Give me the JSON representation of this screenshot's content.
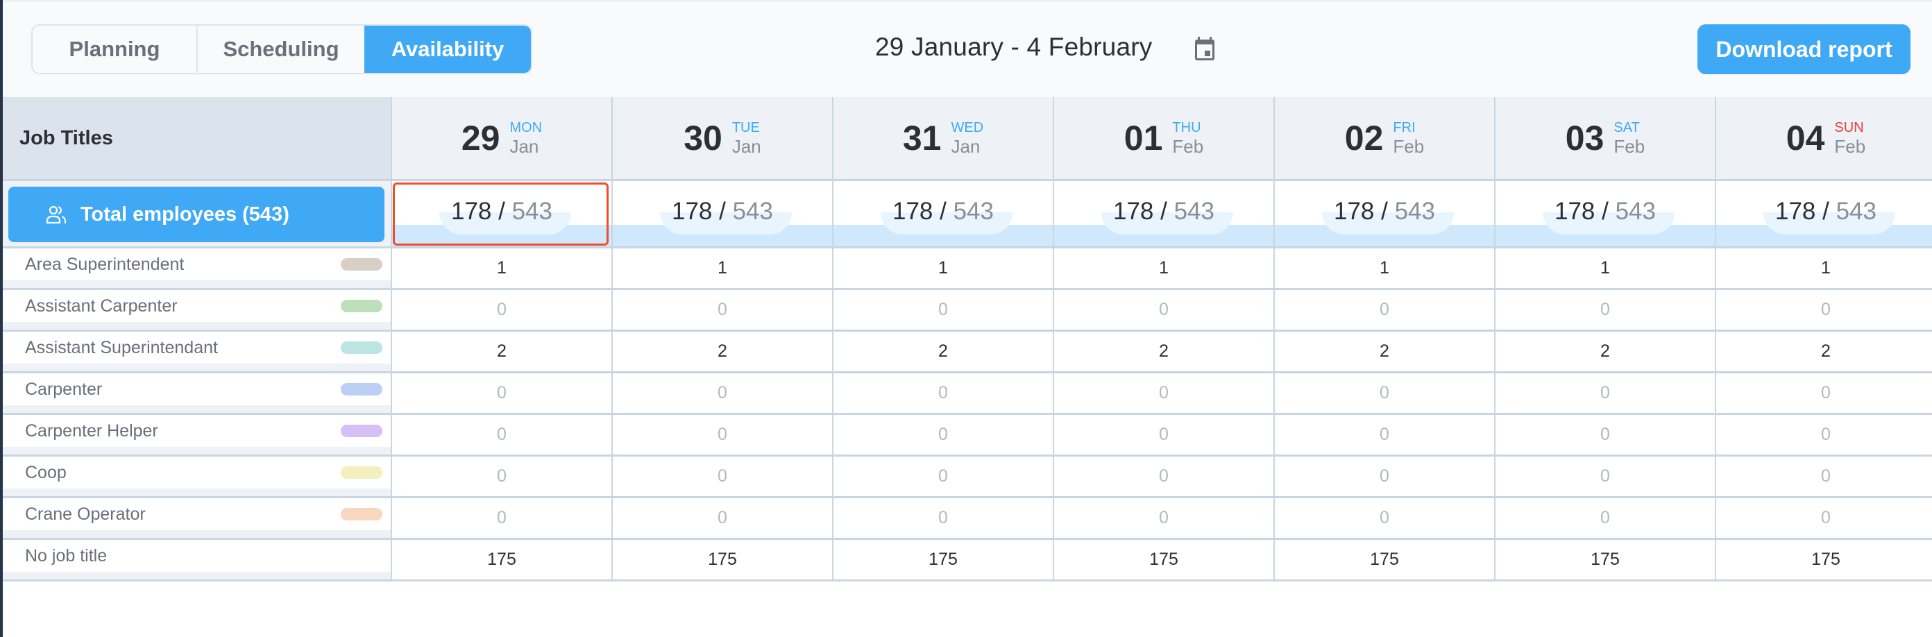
{
  "tabs": [
    {
      "label": "Planning",
      "active": false
    },
    {
      "label": "Scheduling",
      "active": false
    },
    {
      "label": "Availability",
      "active": true
    }
  ],
  "date_range": "29 January - 4 February",
  "calendar_icon": "calendar-icon",
  "download_label": "Download report",
  "colors": {
    "accent": "#3fa9f5",
    "weekday": "#3fa9f5",
    "sunday": "#f03a3a",
    "selection": "#f04e2a"
  },
  "grid": {
    "header_label": "Job Titles",
    "days": [
      {
        "num": "29",
        "dow": "MON",
        "month": "Jan"
      },
      {
        "num": "30",
        "dow": "TUE",
        "month": "Jan"
      },
      {
        "num": "31",
        "dow": "WED",
        "month": "Jan"
      },
      {
        "num": "01",
        "dow": "THU",
        "month": "Feb"
      },
      {
        "num": "02",
        "dow": "FRI",
        "month": "Feb"
      },
      {
        "num": "03",
        "dow": "SAT",
        "month": "Feb"
      },
      {
        "num": "04",
        "dow": "SUN",
        "month": "Feb"
      }
    ],
    "total": {
      "label": "Total employees (543)",
      "icon": "users-icon",
      "values": [
        {
          "available": "178",
          "total": "543",
          "selected": true
        },
        {
          "available": "178",
          "total": "543",
          "selected": false
        },
        {
          "available": "178",
          "total": "543",
          "selected": false
        },
        {
          "available": "178",
          "total": "543",
          "selected": false
        },
        {
          "available": "178",
          "total": "543",
          "selected": false
        },
        {
          "available": "178",
          "total": "543",
          "selected": false
        },
        {
          "available": "178",
          "total": "543",
          "selected": false
        }
      ]
    },
    "rows": [
      {
        "title": "Area Superintendent",
        "color": "#d9d0c5",
        "values": [
          "1",
          "1",
          "1",
          "1",
          "1",
          "1",
          "1"
        ]
      },
      {
        "title": "Assistant Carpenter",
        "color": "#bde0bb",
        "values": [
          "0",
          "0",
          "0",
          "0",
          "0",
          "0",
          "0"
        ]
      },
      {
        "title": "Assistant Superintendant",
        "color": "#bde5e4",
        "values": [
          "2",
          "2",
          "2",
          "2",
          "2",
          "2",
          "2"
        ]
      },
      {
        "title": "Carpenter",
        "color": "#bcd0f6",
        "values": [
          "0",
          "0",
          "0",
          "0",
          "0",
          "0",
          "0"
        ]
      },
      {
        "title": "Carpenter Helper",
        "color": "#d6bff6",
        "values": [
          "0",
          "0",
          "0",
          "0",
          "0",
          "0",
          "0"
        ]
      },
      {
        "title": "Coop",
        "color": "#f4efbe",
        "values": [
          "0",
          "0",
          "0",
          "0",
          "0",
          "0",
          "0"
        ]
      },
      {
        "title": "Crane Operator",
        "color": "#f8d7c0",
        "values": [
          "0",
          "0",
          "0",
          "0",
          "0",
          "0",
          "0"
        ]
      },
      {
        "title": "No job title",
        "color": null,
        "values": [
          "175",
          "175",
          "175",
          "175",
          "175",
          "175",
          "175"
        ]
      }
    ]
  }
}
